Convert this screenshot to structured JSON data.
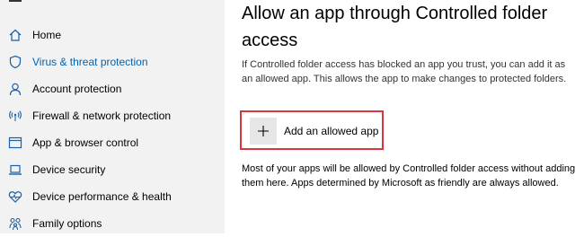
{
  "sidebar": {
    "items": [
      {
        "label": "Home",
        "icon": "home-icon"
      },
      {
        "label": "Virus & threat protection",
        "icon": "shield-icon",
        "active": true
      },
      {
        "label": "Account protection",
        "icon": "person-icon"
      },
      {
        "label": "Firewall & network protection",
        "icon": "wifi-antenna-icon"
      },
      {
        "label": "App & browser control",
        "icon": "browser-window-icon"
      },
      {
        "label": "Device security",
        "icon": "laptop-icon"
      },
      {
        "label": "Device performance & health",
        "icon": "heart-icon"
      },
      {
        "label": "Family options",
        "icon": "family-icon"
      }
    ]
  },
  "main": {
    "title": "Allow an app through Controlled folder access",
    "description": "If Controlled folder access has blocked an app you trust, you can add it as an allowed app. This allows the app to make changes to protected folders.",
    "add_button_label": "Add an allowed app",
    "note": "Most of your apps will be allowed by Controlled folder access without adding them here. Apps determined by Microsoft as friendly are always allowed."
  },
  "colors": {
    "accent": "#0063b1",
    "highlight_border": "#d9363e",
    "sidebar_bg": "#f2f2f2"
  }
}
